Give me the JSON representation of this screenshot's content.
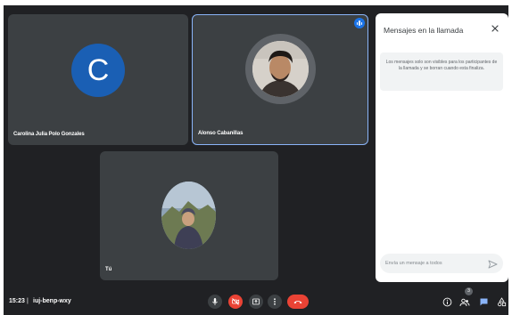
{
  "participants": [
    {
      "name": "Carolina Julia Polo Gonzales",
      "initial": "C",
      "avatar_color": "#1a5fb4"
    },
    {
      "name": "Alonso Cabanillas",
      "speaking": true
    },
    {
      "name": "Tú"
    }
  ],
  "chat": {
    "title": "Mensajes en la llamada",
    "notice": "Los mensajes solo son visibles para los participantes de la llamada y se borran cuando esta finaliza.",
    "input_placeholder": "Envía un mensaje a todos"
  },
  "meeting": {
    "time": "15:23",
    "separator": "|",
    "code": "iuj-benp-wxy"
  },
  "people_count": "3",
  "colors": {
    "background": "#202124",
    "tile": "#3c4043",
    "accent_blue": "#1a73e8",
    "active_border": "#8ab4f8",
    "danger_red": "#ea4335"
  },
  "controls": {
    "mic": "mic-icon",
    "camera": "camera-off-icon",
    "present": "present-icon",
    "more": "more-vert-icon",
    "hangup": "call-end-icon",
    "info": "info-icon",
    "people": "people-icon",
    "chat": "chat-icon",
    "activities": "activities-icon"
  }
}
